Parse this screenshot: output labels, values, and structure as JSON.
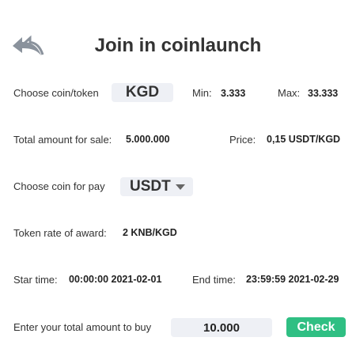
{
  "header": {
    "title": "Join in coinlaunch",
    "back_icon": "double-back-arrow-icon"
  },
  "coin_row": {
    "label": "Choose coin/token",
    "coin": "KGD",
    "min_label": "Min:",
    "min_value": "3.333",
    "max_label": "Max:",
    "max_value": "33.333"
  },
  "sale_row": {
    "total_label": "Total amount for sale:",
    "total_value": "5.000.000",
    "price_label": "Price:",
    "price_value": "0,15 USDT/KGD"
  },
  "pay_row": {
    "label": "Choose coin for pay",
    "selected": "USDT",
    "dropdown_icon": "caret-down-icon"
  },
  "award_row": {
    "label": "Token rate of award:",
    "value": "2 KNB/KGD"
  },
  "time_row": {
    "start_label": "Star time:",
    "start_value": "00:00:00 2021-02-01",
    "end_label": "End time:",
    "end_value": "23:59:59 2021-02-29"
  },
  "buy_row": {
    "label": "Enter your total amount to buy",
    "amount": "10.000",
    "check_label": "Check"
  },
  "colors": {
    "accent": "#2fbf83",
    "pill_bg": "#eef0f5",
    "text": "#333333",
    "icon": "#8a929c"
  }
}
